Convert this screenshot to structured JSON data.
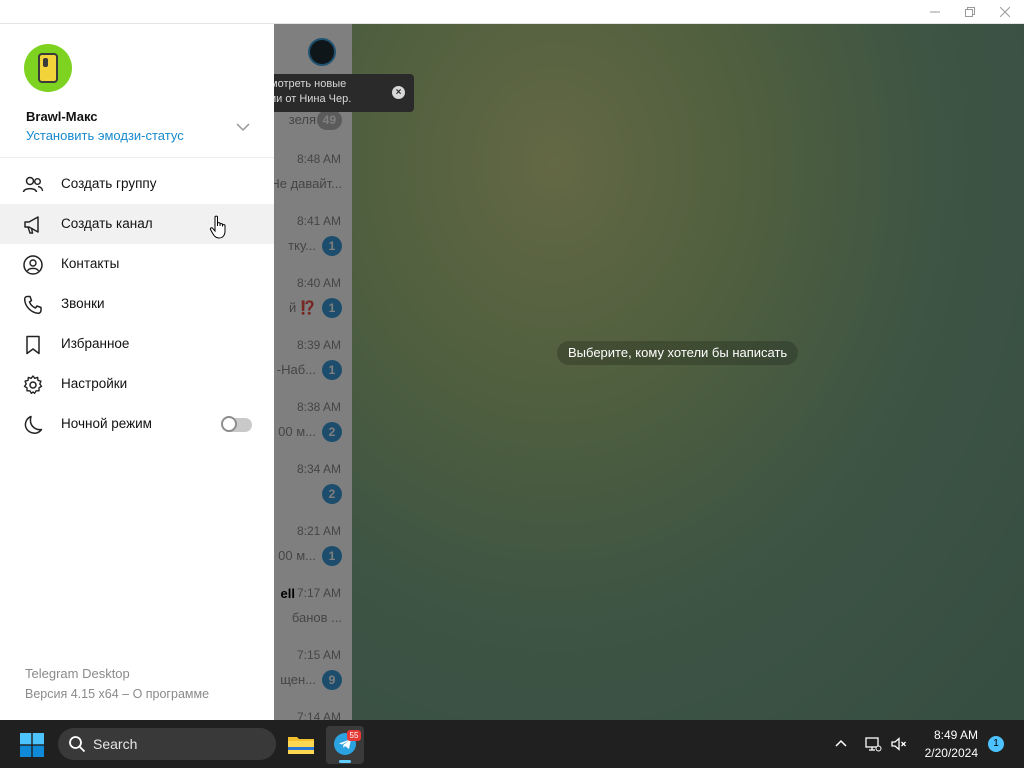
{
  "window": {
    "controls": {
      "minimize": "minimize-icon",
      "restore": "restore-icon",
      "close": "close-icon"
    }
  },
  "chat_list": {
    "tooltip": {
      "line1": "мотреть новые",
      "line2": "ии от Нина Чер."
    },
    "rows": [
      {
        "time": "",
        "preview": "зеля",
        "badge": "49",
        "muted": true
      },
      {
        "time": "8:48 AM",
        "preview": "Не давайт...",
        "badge": ""
      },
      {
        "time": "8:41 AM",
        "preview": "тку...",
        "badge": "1"
      },
      {
        "time": "8:40 AM",
        "preview": "й ⁉️",
        "badge": "1"
      },
      {
        "time": "8:39 AM",
        "preview": "-Наб...",
        "badge": "1"
      },
      {
        "time": "8:38 AM",
        "preview": "00 м...",
        "badge": "2"
      },
      {
        "time": "8:34 AM",
        "preview": "",
        "badge": "2"
      },
      {
        "time": "8:21 AM",
        "preview": "00 м...",
        "badge": "1"
      },
      {
        "time": "7:17 AM",
        "name": "ell",
        "preview": "банов ...",
        "badge": ""
      },
      {
        "time": "7:15 AM",
        "preview": "щен...",
        "badge": "9"
      },
      {
        "time": "7:14 AM",
        "preview": "",
        "badge": ""
      }
    ]
  },
  "chat_area": {
    "empty_hint": "Выберите, кому хотели бы написать"
  },
  "side_menu": {
    "username": "Brawl-Макс",
    "status_link": "Установить эмодзи-статус",
    "items": [
      {
        "label": "Создать группу",
        "icon": "group-icon"
      },
      {
        "label": "Создать канал",
        "icon": "megaphone-icon"
      },
      {
        "label": "Контакты",
        "icon": "contact-icon"
      },
      {
        "label": "Звонки",
        "icon": "phone-icon"
      },
      {
        "label": "Избранное",
        "icon": "bookmark-icon"
      },
      {
        "label": "Настройки",
        "icon": "gear-icon"
      },
      {
        "label": "Ночной режим",
        "icon": "moon-icon",
        "toggle": false
      }
    ],
    "footer": {
      "app_name": "Telegram Desktop",
      "version": "Версия 4.15 x64 – О программе"
    }
  },
  "taskbar": {
    "search_placeholder": "Search",
    "telegram_badge": "55",
    "time": "8:49 AM",
    "date": "2/20/2024",
    "notification_count": "1"
  }
}
